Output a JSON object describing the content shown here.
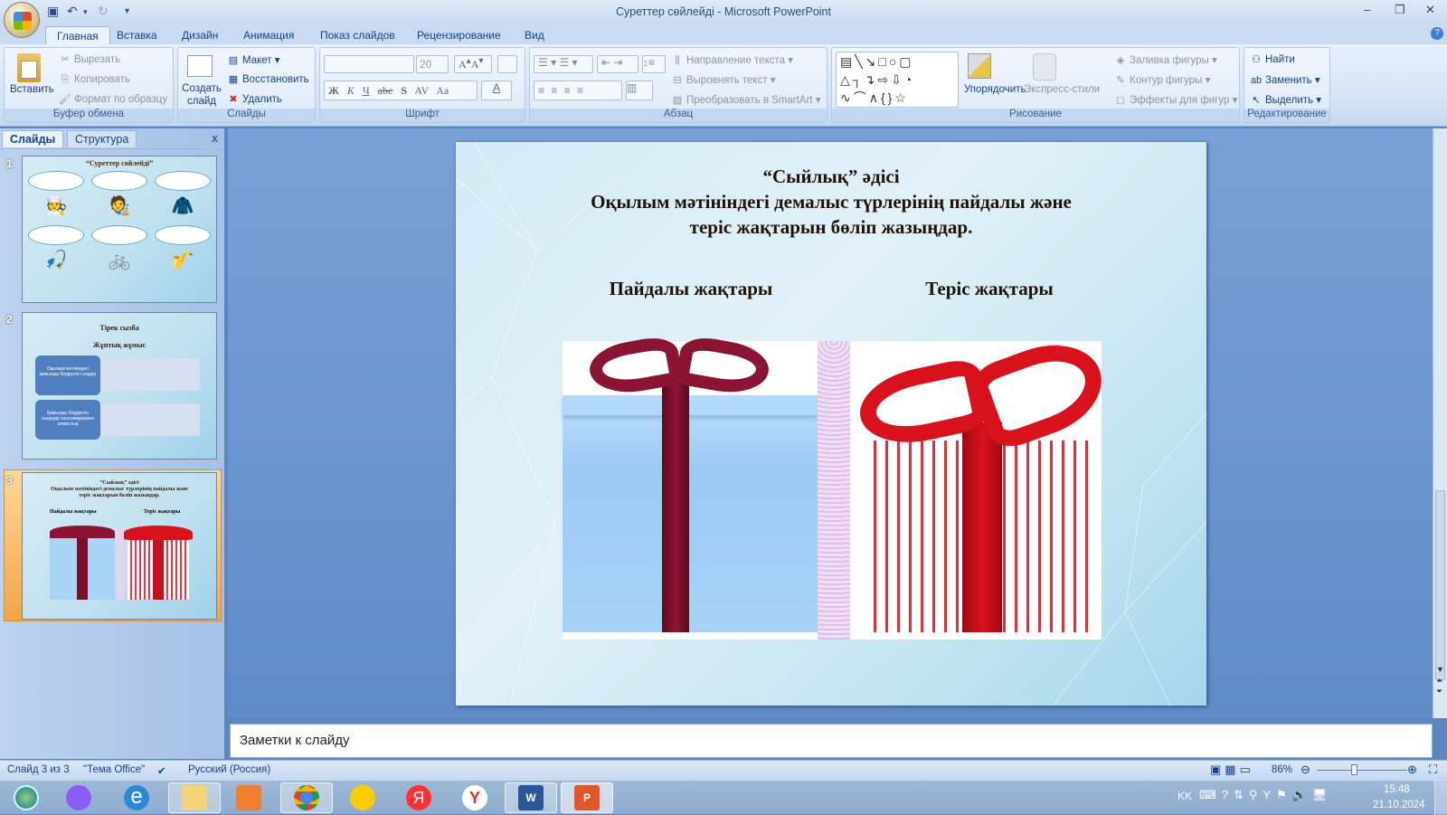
{
  "window": {
    "title": "Суреттер сөйлейді - Microsoft PowerPoint"
  },
  "qat": {
    "save_icon": "save-icon",
    "undo_icon": "undo-icon",
    "redo_icon": "redo-icon",
    "customize": "▾"
  },
  "tabs": [
    {
      "label": "Главная",
      "active": true
    },
    {
      "label": "Вставка"
    },
    {
      "label": "Дизайн"
    },
    {
      "label": "Анимация"
    },
    {
      "label": "Показ слайдов"
    },
    {
      "label": "Рецензирование"
    },
    {
      "label": "Вид"
    }
  ],
  "ribbon": {
    "clipboard": {
      "label": "Буфер обмена",
      "paste": "Вставить",
      "cut": "Вырезать",
      "copy": "Копировать",
      "format_painter": "Формат по образцу"
    },
    "slides": {
      "label": "Слайды",
      "new_slide": "Создать слайд",
      "layout": "Макет",
      "reset": "Восстановить",
      "delete": "Удалить"
    },
    "font": {
      "label": "Шрифт",
      "font_name": "",
      "font_size": "20",
      "bold": "Ж",
      "italic": "К",
      "underline": "Ч",
      "strike": "abc",
      "shadow": "S",
      "spacing": "AV",
      "case": "Aa",
      "color": "A"
    },
    "paragraph": {
      "label": "Абзац",
      "text_direction": "Направление текста",
      "align_text": "Выровнять текст",
      "smartart": "Преобразовать в SmartArt"
    },
    "drawing": {
      "label": "Рисование",
      "arrange": "Упорядочить",
      "quick_styles": "Экспресс-стили",
      "fill": "Заливка фигуры",
      "outline": "Контур фигуры",
      "effects": "Эффекты для фигур"
    },
    "editing": {
      "label": "Редактирование",
      "find": "Найти",
      "replace": "Заменить",
      "select": "Выделить"
    }
  },
  "panel": {
    "tabs": [
      "Слайды",
      "Структура"
    ],
    "close": "x",
    "thumbs": [
      {
        "num": "1",
        "title": "“Суреттер сөйлейді”"
      },
      {
        "num": "2",
        "title": "Тірек сызба",
        "subtitle": "Жұптық жұмыс",
        "boxes": [
          "Оқылым мәтініндегі қимылды білдіретін сөздер",
          "Қимылды білдіретін сөздерді синонимдермен алмастыр"
        ]
      },
      {
        "num": "3",
        "title": "“Сыйлық” әдісі",
        "line2": "Оқылым  мәтініндегі демалыс түрлерінің пайдалы және",
        "line3": "теріс жақтарын бөліп жазыңдар.",
        "left": "Пайдалы жақтары",
        "right": "Теріс жақтары",
        "selected": true
      }
    ]
  },
  "slide": {
    "title": "“Сыйлық” әдісі",
    "line2": "Оқылым  мәтініндегі демалыс түрлерінің пайдалы және",
    "line3": "теріс жақтарын бөліп жазыңдар.",
    "left_heading": "Пайдалы жақтары",
    "right_heading": "Теріс жақтары"
  },
  "notes": {
    "placeholder": "Заметки к слайду"
  },
  "status": {
    "slide": "Слайд 3 из 3",
    "theme": "\"Тема Office\"",
    "language": "Русский (Россия)",
    "zoom": "86%",
    "zoom_percent": 86
  },
  "taskbar": {
    "lang": "KK",
    "time": "15:48",
    "date": "21.10.2024",
    "apps": [
      "start",
      "alice",
      "internet-explorer",
      "file-explorer",
      "media-player",
      "chrome",
      "yandex-music",
      "yandex",
      "yandex-browser",
      "word",
      "powerpoint"
    ]
  },
  "colors": {
    "ribbon": "#d4e3f6",
    "selected_thumb": "#f2a646",
    "blue_box": "#9fcff5",
    "red_ribbon": "#c8101a",
    "dark_ribbon": "#7a0f2a"
  }
}
